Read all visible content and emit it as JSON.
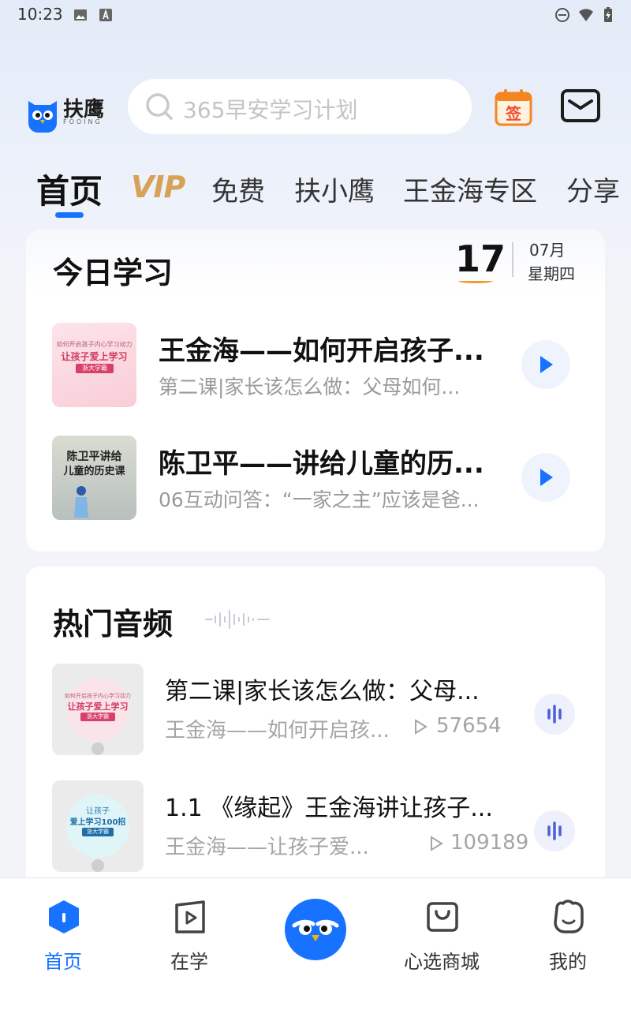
{
  "status_bar": {
    "time": "10:23"
  },
  "header": {
    "logo_text": "扶鹰",
    "logo_sub": "FOOING",
    "search_placeholder": "365早安学习计划",
    "sign_label": "签"
  },
  "tabs": [
    {
      "label": "首页"
    },
    {
      "label": "VIP"
    },
    {
      "label": "免费"
    },
    {
      "label": "扶小鹰"
    },
    {
      "label": "王金海专区"
    },
    {
      "label": "分享"
    }
  ],
  "today": {
    "title": "今日学习",
    "day": "17",
    "month": "07月",
    "weekday": "星期四",
    "items": [
      {
        "title": "王金海——如何开启孩子...",
        "subtitle": "第二课|家长该怎么做：父母如何...",
        "thumb_lines": [
          "如何开启孩子内心学习动力",
          "让孩子爱上学习",
          "浙大学霸"
        ]
      },
      {
        "title": "陈卫平——讲给儿童的历...",
        "subtitle": "06互动问答：“一家之主”应该是爸...",
        "thumb_lines": [
          "陈卫平讲给",
          "儿童的历史课"
        ]
      }
    ]
  },
  "hot": {
    "title": "热门音频",
    "items": [
      {
        "title": "第二课|家长该怎么做：父母...",
        "subtitle": "王金海——如何开启孩...",
        "plays": "57654",
        "thumb_lines": [
          "如何开启孩子内心学习动力",
          "让孩子爱上学习",
          "浙大学霸"
        ]
      },
      {
        "title": "1.1 《缘起》王金海讲让孩子...",
        "subtitle": "王金海——让孩子爱...",
        "plays": "109189",
        "thumb_lines": [
          "让孩子",
          "爱上学习100招",
          "浙大学霸"
        ]
      }
    ]
  },
  "bottom_nav": [
    {
      "label": "首页"
    },
    {
      "label": "在学"
    },
    {
      "label": ""
    },
    {
      "label": "心选商城"
    },
    {
      "label": "我的"
    }
  ],
  "colors": {
    "accent": "#1773ff",
    "vip": "#d7a157",
    "date_underline": "#f39a1e"
  }
}
